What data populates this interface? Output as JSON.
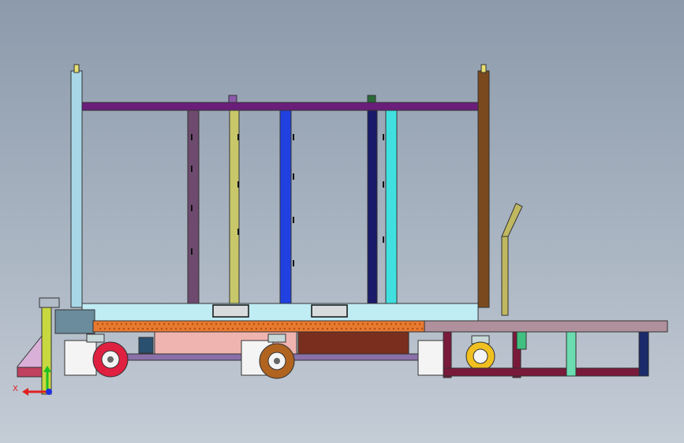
{
  "view": {
    "background_top": "#8c9aab",
    "background_bottom": "#c4ccd6"
  },
  "triad": {
    "x_label": "X",
    "y_label": "",
    "x_color": "#e02020",
    "y_color": "#20c020",
    "z_color": "#2030e0"
  },
  "colors": {
    "upright_left": "#a8d8e8",
    "upright_right": "#7a4a1e",
    "top_rail": "#6a1e7a",
    "post_purple": "#6e4a6e",
    "post_olive": "#c8c86a",
    "post_blue": "#2040e0",
    "post_navy": "#1a1a6a",
    "post_cyan": "#40e0e0",
    "base_frame": "#c0ecf4",
    "orange_rail": "#e87a30",
    "pink_block": "#f0b4b0",
    "brown_block": "#7a2e1e",
    "trailer_frame": "#7a1a3a",
    "trailer_deck": "#b0909c",
    "handle": "#c0b860",
    "wheel_red": "#e02040",
    "wheel_bronze": "#b06420",
    "wheel_yellow": "#f0c020"
  },
  "icons": [
    "axis-triad-icon",
    "caster-wheel-icon"
  ]
}
